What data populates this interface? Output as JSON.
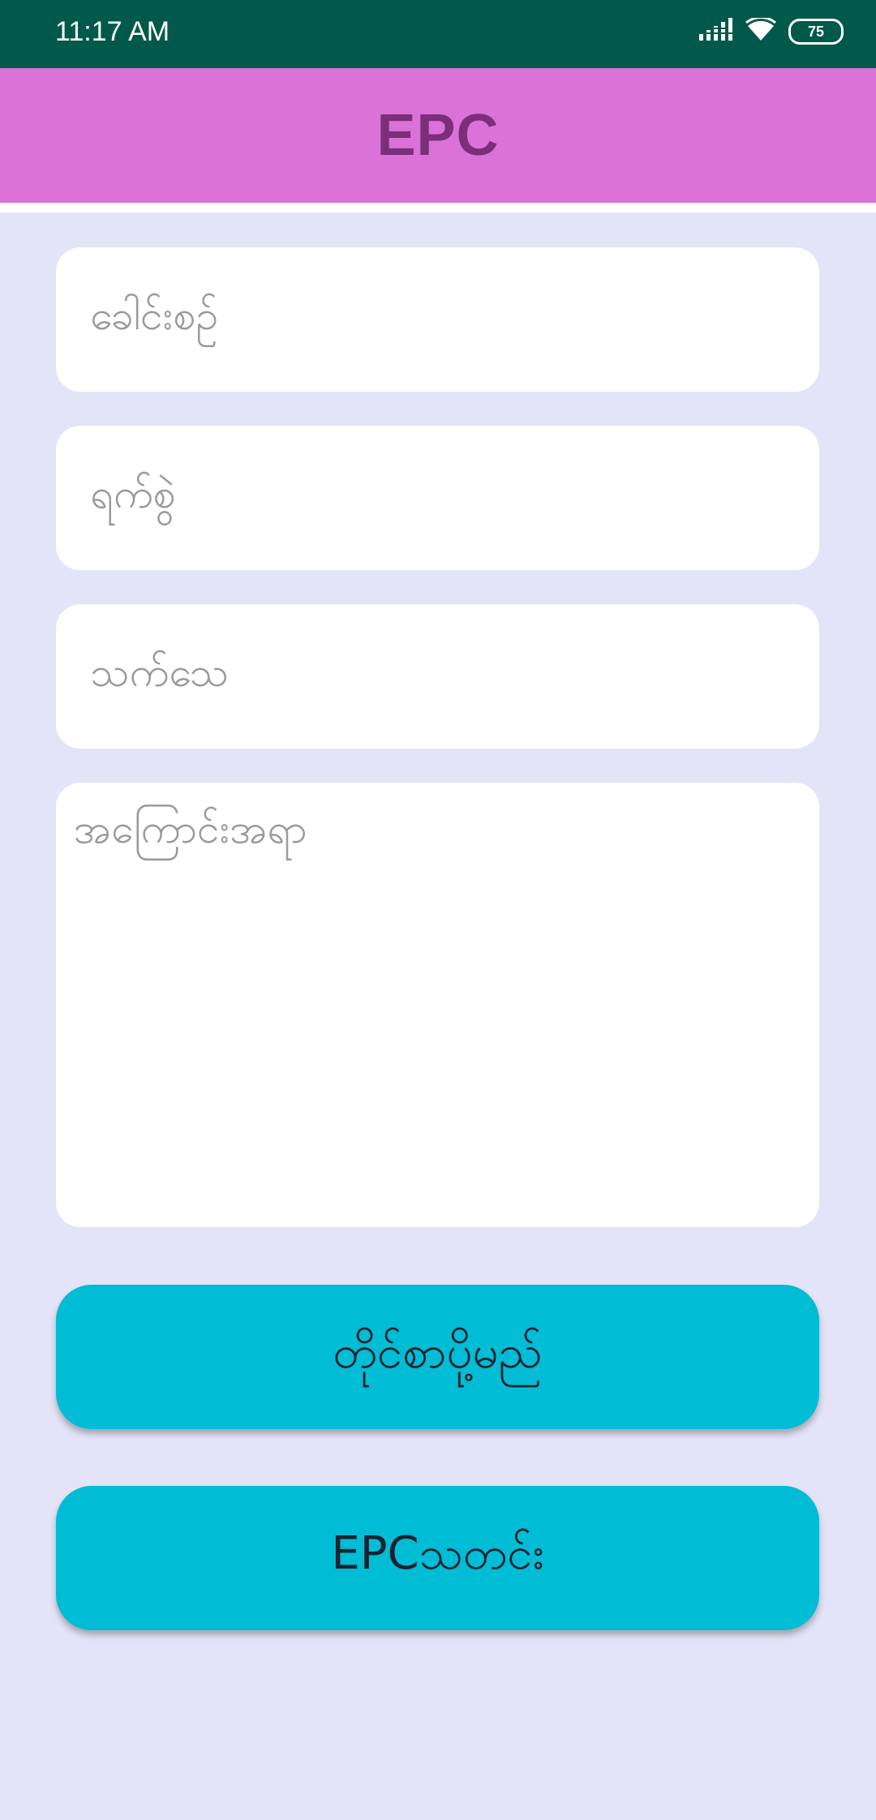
{
  "status_bar": {
    "time": "11:17 AM",
    "battery": "75",
    "icons": [
      "signal-icon",
      "wifi-icon",
      "battery-icon"
    ]
  },
  "app_bar": {
    "title": "EPC"
  },
  "form": {
    "name_placeholder": "ခေါင်းစဥ်",
    "date_placeholder": "ရက်စွဲ",
    "sender_placeholder": "သက်သေ",
    "description_placeholder": "အကြောင်းအရာ"
  },
  "buttons": {
    "register_label": "တိုင်စာပို့မည်",
    "news_label": "EPCသတင်း"
  },
  "colors": {
    "status_bar": "#01594c",
    "app_bar": "#db72d8",
    "title": "#7a2f78",
    "background": "#e4e4f8",
    "button": "#00bcd4"
  }
}
